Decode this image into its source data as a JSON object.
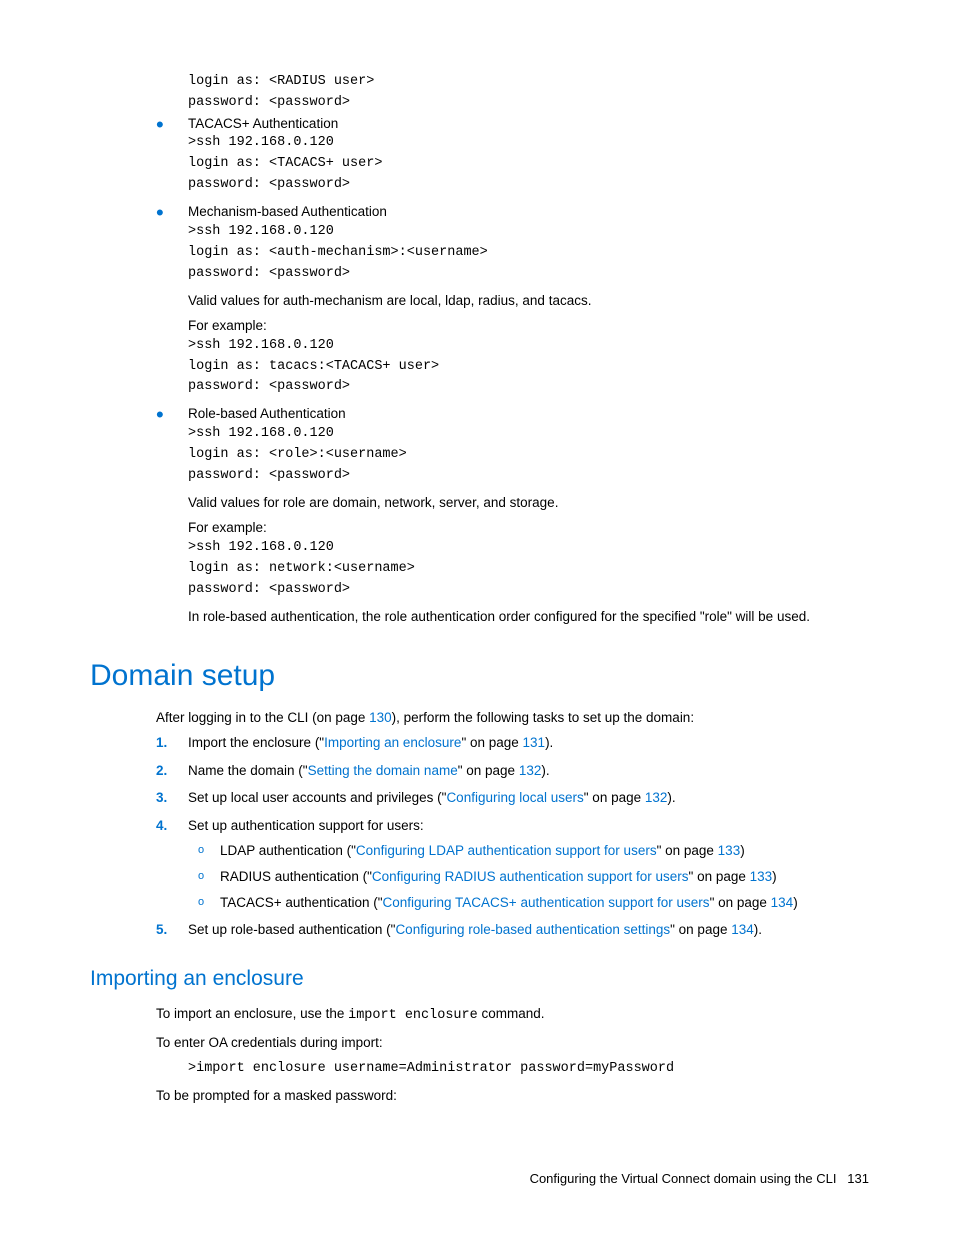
{
  "top_code": "login as: <RADIUS user>\npassword: <password>",
  "bullets": [
    {
      "title": "TACACS+ Authentication",
      "code": ">ssh 192.168.0.120\nlogin as: <TACACS+ user>\npassword: <password>"
    },
    {
      "title": "Mechanism-based Authentication",
      "code": ">ssh 192.168.0.120\nlogin as: <auth-mechanism>:<username>\npassword: <password>",
      "after1": "Valid values for auth-mechanism are local, ldap, radius, and tacacs.",
      "example_label": "For example:",
      "example_code": ">ssh 192.168.0.120\nlogin as: tacacs:<TACACS+ user>\npassword: <password>"
    },
    {
      "title": "Role-based Authentication",
      "code": ">ssh 192.168.0.120\nlogin as: <role>:<username>\npassword: <password>",
      "after1": "Valid values for role are domain, network, server, and storage.",
      "example_label": "For example:",
      "example_code": ">ssh 192.168.0.120\nlogin as: network:<username>\npassword: <password>",
      "after2": "In role-based authentication, the role authentication order configured for the specified \"role\" will be used."
    }
  ],
  "h1": "Domain setup",
  "domain_intro_pre": "After logging in to the CLI (on page ",
  "domain_intro_link": "130",
  "domain_intro_post": "), perform the following tasks to set up the domain:",
  "steps": {
    "s1_pre": "Import the enclosure (\"",
    "s1_link": "Importing an enclosure",
    "s1_mid": "\" on page ",
    "s1_page": "131",
    "s1_post": ").",
    "s2_pre": "Name the domain (\"",
    "s2_link": "Setting the domain name",
    "s2_mid": "\" on page ",
    "s2_page": "132",
    "s2_post": ").",
    "s3_pre": "Set up local user accounts and privileges (\"",
    "s3_link": "Configuring local users",
    "s3_mid": "\" on page ",
    "s3_page": "132",
    "s3_post": ").",
    "s4": "Set up authentication support for users:",
    "s4a_pre": "LDAP authentication (\"",
    "s4a_link": "Configuring LDAP authentication support for users",
    "s4a_mid": "\" on page ",
    "s4a_page": "133",
    "s4a_post": ")",
    "s4b_pre": "RADIUS authentication (\"",
    "s4b_link": "Configuring RADIUS authentication support for users",
    "s4b_mid": "\" on page ",
    "s4b_page": "133",
    "s4b_post": ")",
    "s4c_pre": "TACACS+ authentication (\"",
    "s4c_link": "Configuring TACACS+ authentication support for users",
    "s4c_mid": "\" on page ",
    "s4c_page": "134",
    "s4c_post": ")",
    "s5_pre": "Set up role-based authentication (\"",
    "s5_link": "Configuring role-based authentication settings",
    "s5_mid": "\" on page ",
    "s5_page": "134",
    "s5_post": ")."
  },
  "h2": "Importing an enclosure",
  "enc_p1_pre": "To import an enclosure, use the ",
  "enc_p1_code": "import enclosure",
  "enc_p1_post": " command.",
  "enc_p2": "To enter OA credentials during import:",
  "enc_code": ">import enclosure username=Administrator password=myPassword",
  "enc_p3": "To be prompted for a masked password:",
  "footer_text": "Configuring the Virtual Connect domain using the CLI",
  "footer_page": "131"
}
